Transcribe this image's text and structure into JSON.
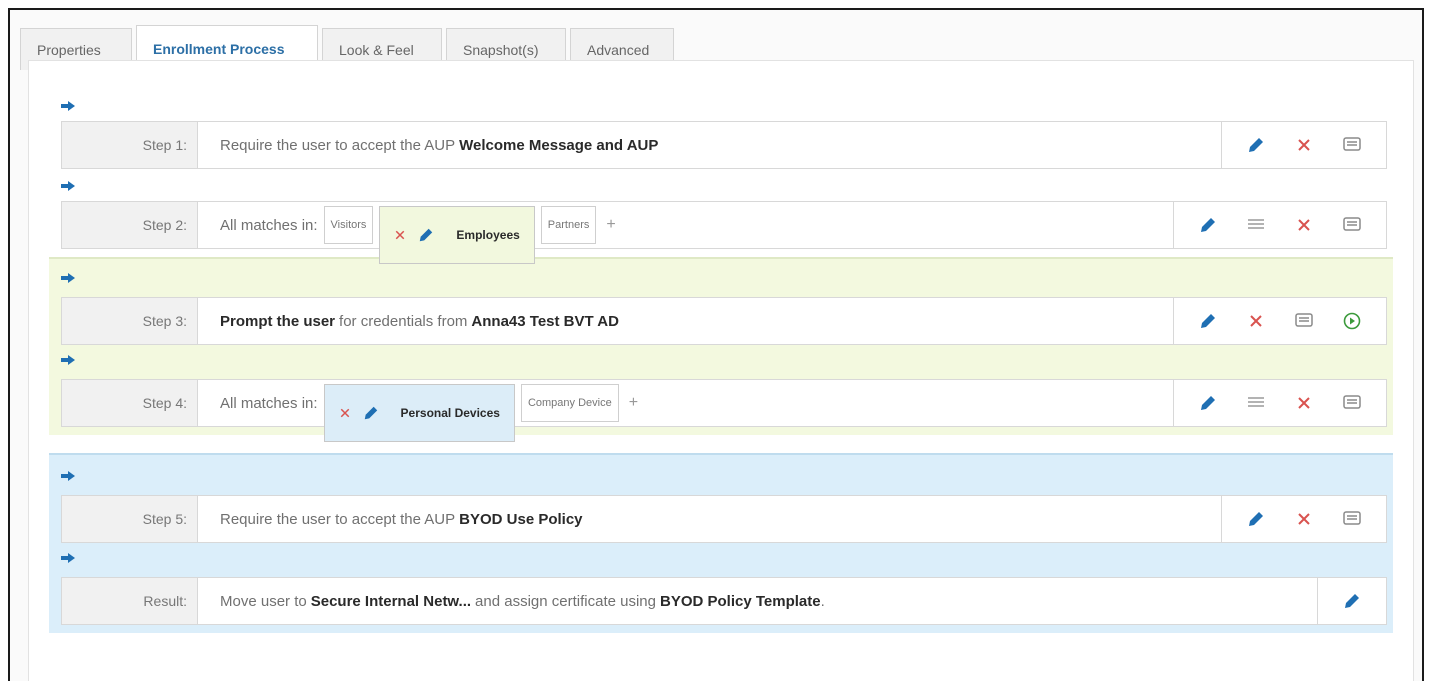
{
  "tabs": [
    "Properties",
    "Enrollment Process",
    "Look & Feel",
    "Snapshot(s)",
    "Advanced"
  ],
  "active_tab": "Enrollment Process",
  "steps": [
    {
      "label": "Step 1:",
      "pre": "Require the user to accept the AUP",
      "bold": "Welcome Message and AUP"
    },
    {
      "label": "Step 2:",
      "lead": "All matches in:",
      "chips": [
        "Visitors",
        "Employees",
        "Partners"
      ],
      "plus": "+"
    },
    {
      "label": "Step 3:",
      "bold1": "Prompt the user",
      "mid": "for credentials from",
      "bold2": "Anna43 Test BVT AD"
    },
    {
      "label": "Step 4:",
      "lead": "All matches in:",
      "chips": [
        "Personal Devices",
        "Company Device"
      ],
      "plus": "+"
    },
    {
      "label": "Step 5:",
      "pre": "Require the user to accept the AUP",
      "bold": "BYOD Use Policy"
    },
    {
      "label": "Result:",
      "pre": "Move user to",
      "bold1": "Secure Internal Netw...",
      "mid": "and assign certificate using",
      "bold2": "BYOD Policy Template",
      "post": "."
    }
  ],
  "icons": {
    "edit": "pencil-icon",
    "delete": "close-icon",
    "comment": "comment-icon",
    "list": "list-icon",
    "play": "play-circle-icon",
    "arrow": "arrow-right-icon"
  },
  "colors": {
    "accent": "#1f6fb3",
    "delete": "#d9534f",
    "play": "#3b9a3b",
    "green_bg": "#f3f9df",
    "blue_bg": "#dbeefa"
  }
}
